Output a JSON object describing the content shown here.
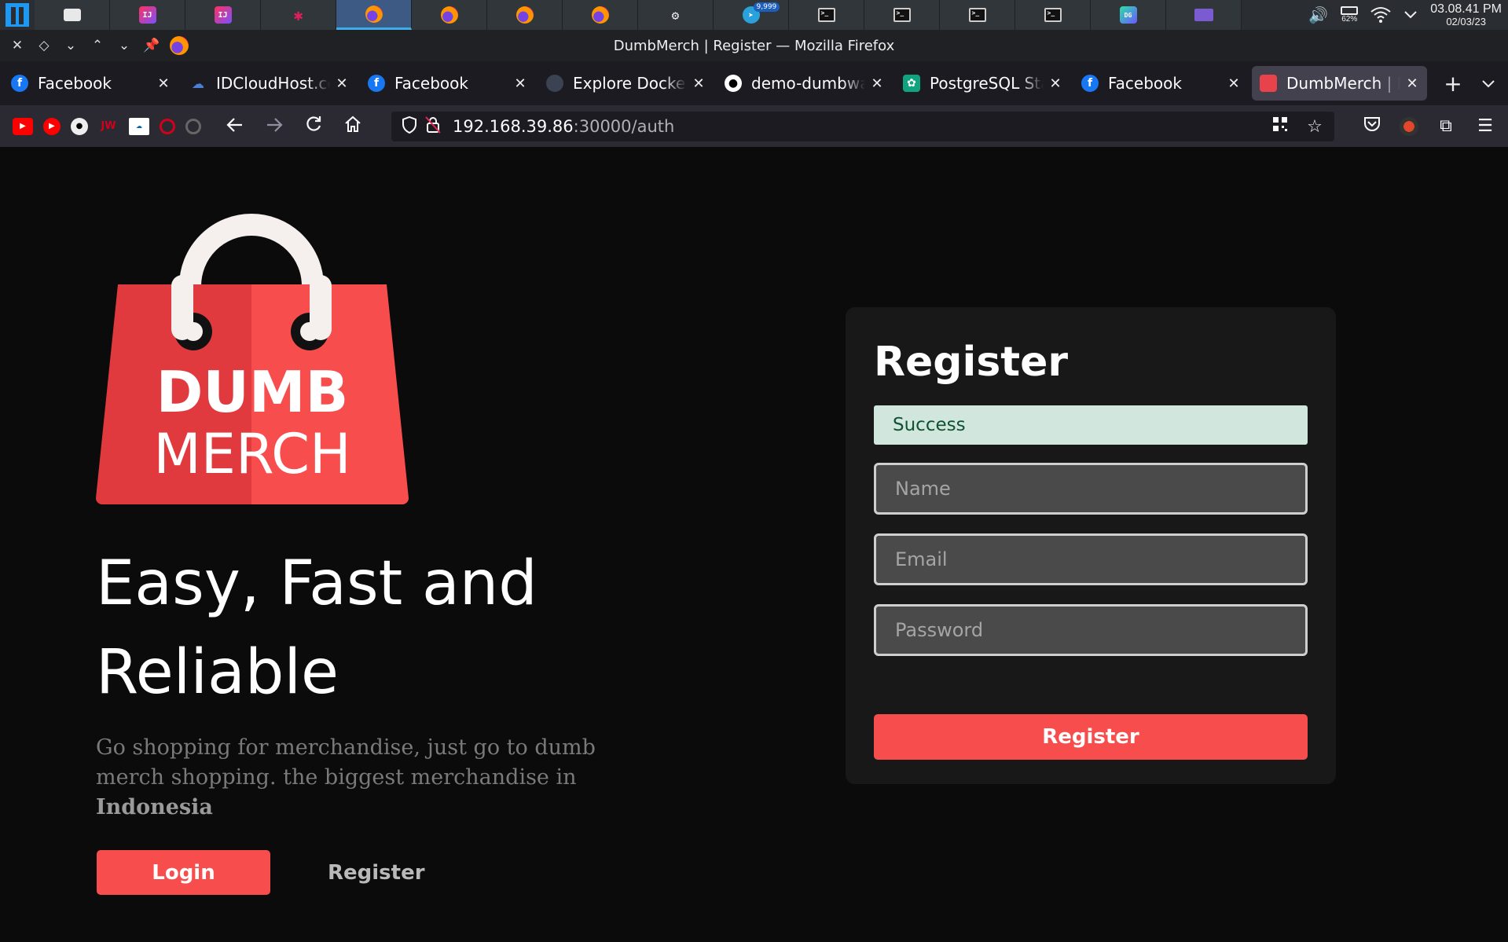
{
  "taskbar": {
    "items": [
      {
        "icon": "file-manager-icon"
      },
      {
        "icon": "intellij-icon"
      },
      {
        "icon": "intellij-icon"
      },
      {
        "icon": "slack-icon"
      },
      {
        "icon": "firefox-icon",
        "active": true
      },
      {
        "icon": "firefox-icon"
      },
      {
        "icon": "firefox-icon"
      },
      {
        "icon": "firefox-icon"
      },
      {
        "icon": "settings-icon"
      },
      {
        "icon": "telegram-icon",
        "badge": "9,999"
      },
      {
        "icon": "terminal-icon"
      },
      {
        "icon": "terminal-icon"
      },
      {
        "icon": "terminal-icon"
      },
      {
        "icon": "terminal-icon"
      },
      {
        "icon": "datagrip-icon"
      },
      {
        "icon": "screen-icon"
      }
    ],
    "battery": "62%",
    "time": "03.08.41 PM",
    "date": "02/03/23"
  },
  "window": {
    "title": "DumbMerch | Register — Mozilla Firefox"
  },
  "tabs": [
    {
      "label": "Facebook",
      "favicon": "facebook-icon"
    },
    {
      "label": "IDCloudHost.com",
      "favicon": "cloud-icon"
    },
    {
      "label": "Facebook",
      "favicon": "facebook-icon"
    },
    {
      "label": "Explore Docker",
      "favicon": "docker-icon"
    },
    {
      "label": "demo-dumbways",
      "favicon": "github-icon"
    },
    {
      "label": "PostgreSQL Start",
      "favicon": "chatgpt-icon"
    },
    {
      "label": "Facebook",
      "favicon": "facebook-icon"
    },
    {
      "label": "DumbMerch | Register",
      "favicon": "dumbmerch-icon",
      "active": true
    }
  ],
  "address": {
    "host": "192.168.39.86",
    "path": ":30000/auth"
  },
  "brand": {
    "logo_line1": "DUMB",
    "logo_line2": "MERCH",
    "colors": {
      "bag_left": "#e03a3e",
      "bag_right": "#f74d4d",
      "handle": "#f5f0ee"
    }
  },
  "hero": {
    "headline": "Easy, Fast and Reliable",
    "subtext_prefix": "Go shopping for merchandise, just go to dumb merch shopping. the biggest merchandise in ",
    "subtext_bold": "Indonesia"
  },
  "actions": {
    "login": "Login",
    "register": "Register"
  },
  "form": {
    "title": "Register",
    "alert": "Success",
    "name_placeholder": "Name",
    "email_placeholder": "Email",
    "password_placeholder": "Password",
    "submit": "Register"
  },
  "colors": {
    "accent": "#f74d4d",
    "background": "#0b0b0b",
    "card": "#181818",
    "alert_bg": "#d1e7dd",
    "alert_text": "#0f5132"
  }
}
